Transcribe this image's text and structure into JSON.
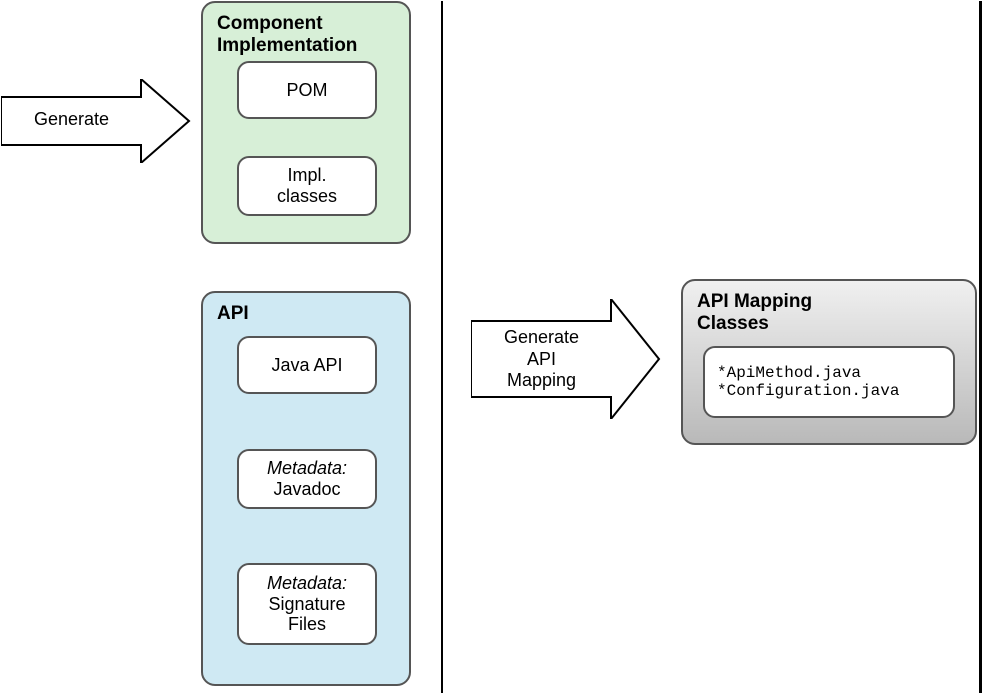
{
  "arrows": {
    "generate": "Generate",
    "generate_mapping_line1": "Generate",
    "generate_mapping_line2": "API",
    "generate_mapping_line3": "Mapping"
  },
  "component_impl": {
    "title_line1": "Component",
    "title_line2": "Implementation",
    "pom": "POM",
    "impl_line1": "Impl.",
    "impl_line2": "classes"
  },
  "api": {
    "title": "API",
    "java_api": "Java API",
    "javadoc_meta": "Metadata:",
    "javadoc": "Javadoc",
    "sig_meta": "Metadata:",
    "sig_line1": "Signature",
    "sig_line2": "Files"
  },
  "mapping": {
    "title_line1": "API Mapping",
    "title_line2": "Classes",
    "file1": "*ApiMethod.java",
    "file2": "*Configuration.java"
  }
}
